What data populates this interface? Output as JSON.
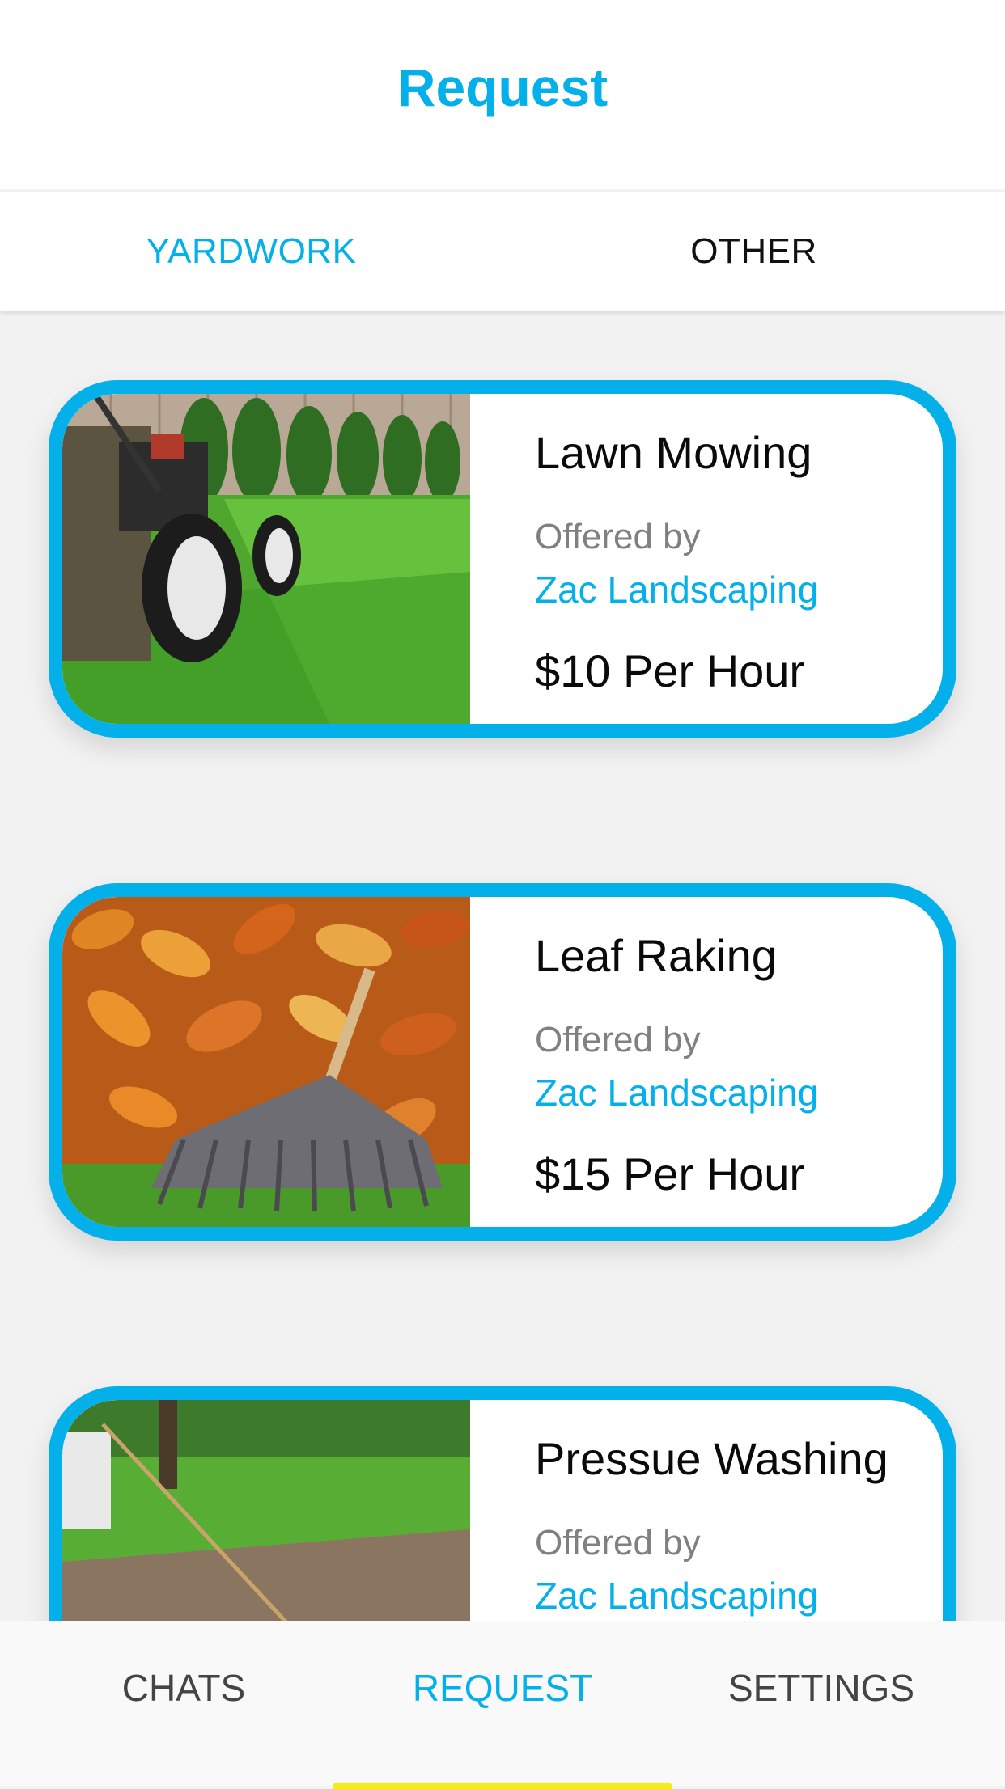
{
  "header": {
    "title": "Request"
  },
  "tabs": [
    {
      "label": "YARDWORK",
      "active": true
    },
    {
      "label": "OTHER",
      "active": false
    }
  ],
  "colors": {
    "accent": "#03b0ea",
    "indicator": "#f5ea1a"
  },
  "services": [
    {
      "title": "Lawn Mowing",
      "offered_label": "Offered by",
      "provider": "Zac Landscaping",
      "price": "$10 Per Hour",
      "image": "lawn-mower-photo"
    },
    {
      "title": "Leaf Raking",
      "offered_label": "Offered by",
      "provider": "Zac Landscaping",
      "price": "$15 Per Hour",
      "image": "leaf-rake-photo"
    },
    {
      "title": "Pressue Washing",
      "offered_label": "Offered by",
      "provider": "Zac Landscaping",
      "price": "",
      "image": "pressure-washing-photo"
    }
  ],
  "bottom_nav": [
    {
      "label": "CHATS",
      "active": false
    },
    {
      "label": "REQUEST",
      "active": true
    },
    {
      "label": "SETTINGS",
      "active": false
    }
  ]
}
